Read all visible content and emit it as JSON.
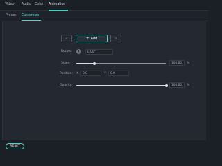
{
  "top_tabs": [
    {
      "label": "Video",
      "active": false
    },
    {
      "label": "Audio",
      "active": false
    },
    {
      "label": "Color",
      "active": false
    },
    {
      "label": "Animation",
      "active": true
    }
  ],
  "sub_tabs": [
    {
      "label": "Preset",
      "active": false
    },
    {
      "label": "Customize",
      "active": true
    }
  ],
  "keyframe": {
    "prev_glyph": "<",
    "add_label": "Add",
    "add_icon": "plus-icon",
    "next_glyph": "×"
  },
  "rotate": {
    "label": "Rotate:",
    "value": "0.00°"
  },
  "scale": {
    "label": "Scale:",
    "value": "100.00",
    "unit": "%",
    "fraction": 0.2
  },
  "position": {
    "label": "Position:",
    "x_label": "X",
    "x_value": "0.0",
    "y_label": "Y",
    "y_value": "0.0"
  },
  "opacity": {
    "label": "Opacity:",
    "value": "100.00",
    "unit": "%",
    "fraction": 1.0
  },
  "footer": {
    "reset_label": "RESET"
  },
  "colors": {
    "accent": "#4fd0c2",
    "background": "#1b1f26",
    "panel": "#232831"
  }
}
